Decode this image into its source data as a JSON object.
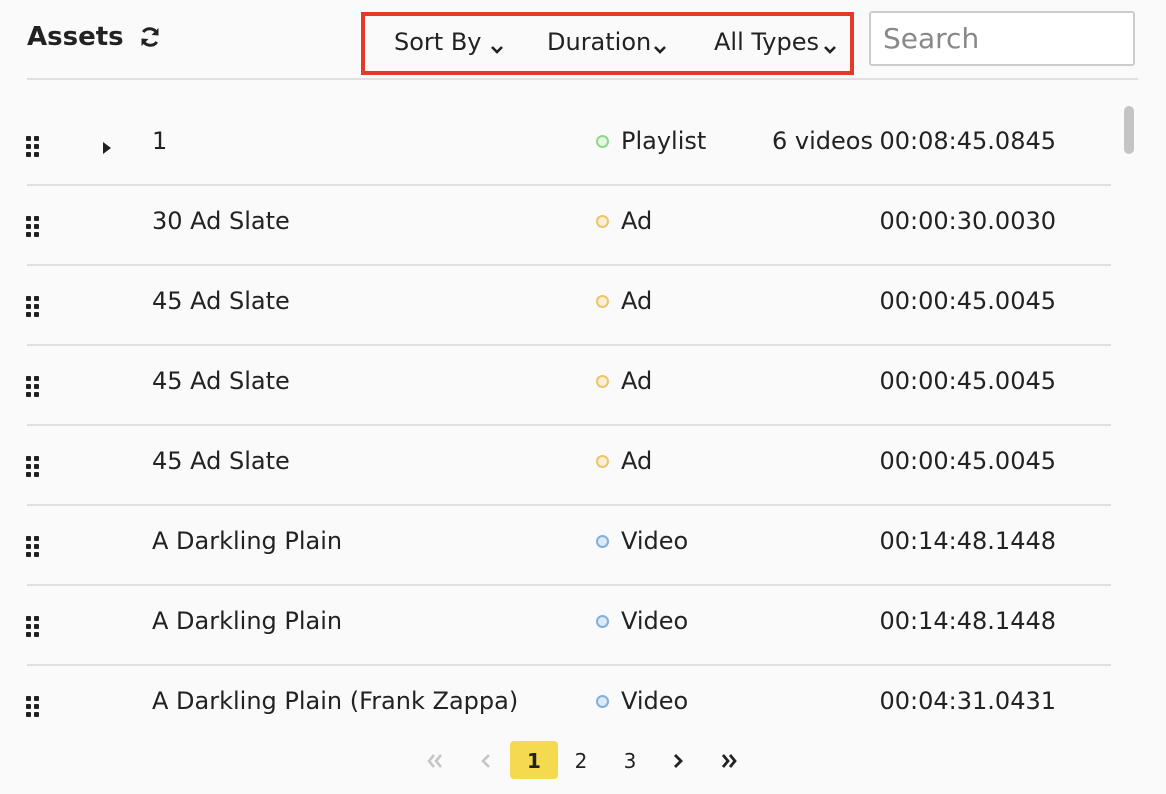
{
  "header": {
    "title": "Assets",
    "refresh_icon": "refresh-icon"
  },
  "filters": {
    "sort_by": "Sort By",
    "duration": "Duration",
    "all_types": "All Types",
    "highlight_color": "#e8382a"
  },
  "search": {
    "placeholder": "Search",
    "value": ""
  },
  "type_colors": {
    "Playlist": {
      "fill": "#e6f7e4",
      "stroke": "#8fd88a"
    },
    "Ad": {
      "fill": "#fbefd2",
      "stroke": "#eec46a"
    },
    "Video": {
      "fill": "#dceaf8",
      "stroke": "#7fb1e0"
    }
  },
  "rows": [
    {
      "name": "1",
      "type": "Playlist",
      "count": "6 videos",
      "duration": "00:08:45.0845",
      "expandable": true
    },
    {
      "name": "30 Ad Slate",
      "type": "Ad",
      "count": "",
      "duration": "00:00:30.0030",
      "expandable": false
    },
    {
      "name": "45 Ad Slate",
      "type": "Ad",
      "count": "",
      "duration": "00:00:45.0045",
      "expandable": false
    },
    {
      "name": "45 Ad Slate",
      "type": "Ad",
      "count": "",
      "duration": "00:00:45.0045",
      "expandable": false
    },
    {
      "name": "45 Ad Slate",
      "type": "Ad",
      "count": "",
      "duration": "00:00:45.0045",
      "expandable": false
    },
    {
      "name": "A Darkling Plain",
      "type": "Video",
      "count": "",
      "duration": "00:14:48.1448",
      "expandable": false
    },
    {
      "name": "A Darkling Plain",
      "type": "Video",
      "count": "",
      "duration": "00:14:48.1448",
      "expandable": false
    },
    {
      "name": "A Darkling Plain (Frank Zappa)",
      "type": "Video",
      "count": "",
      "duration": "00:04:31.0431",
      "expandable": false
    }
  ],
  "pagination": {
    "first": "«",
    "prev": "‹",
    "pages": [
      "1",
      "2",
      "3"
    ],
    "current": "1",
    "next": "›",
    "last": "»"
  }
}
